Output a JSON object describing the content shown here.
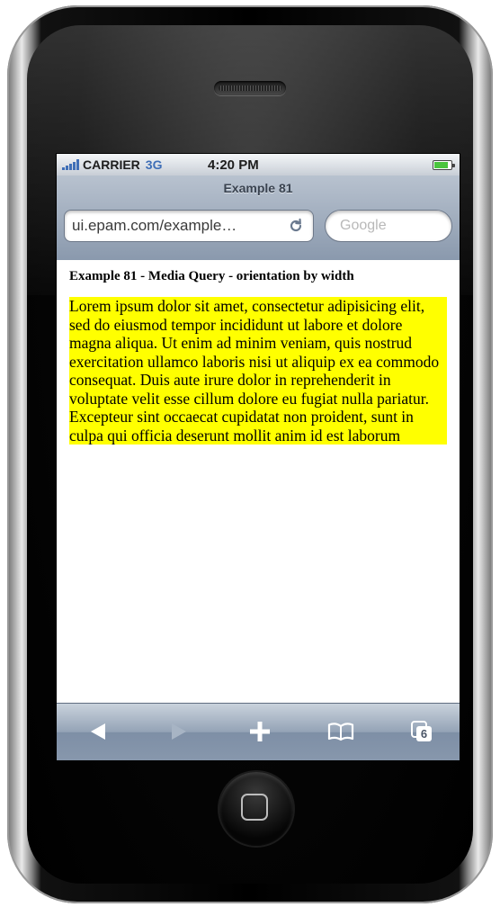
{
  "status_bar": {
    "carrier": "CARRIER",
    "network": "3G",
    "time": "4:20 PM",
    "battery_level": 0.85,
    "icons": [
      "signal-bars-icon",
      "battery-icon"
    ]
  },
  "browser": {
    "page_title": "Example 81",
    "url": "ui.epam.com/example…",
    "search_placeholder": "Google",
    "icons": [
      "reload-icon"
    ]
  },
  "content": {
    "heading": "Example 81 - Media Query - orientation by width",
    "paragraph": "Lorem ipsum dolor sit amet, consectetur adipisicing elit, sed do eiusmod tempor incididunt ut labore et dolore magna aliqua. Ut enim ad minim veniam, quis nostrud exercitation ullamco laboris nisi ut aliquip ex ea commodo consequat. Duis aute irure dolor in reprehenderit in voluptate velit esse cillum dolore eu fugiat nulla pariatur. Excepteur sint occaecat cupidatat non proident, sunt in culpa qui officia deserunt mollit anim id est laborum",
    "highlight_color": "#ffff00"
  },
  "toolbar": {
    "tabs_count": "6",
    "icons": [
      "back-icon",
      "forward-icon",
      "add-icon",
      "bookmarks-icon",
      "tabs-icon"
    ]
  }
}
